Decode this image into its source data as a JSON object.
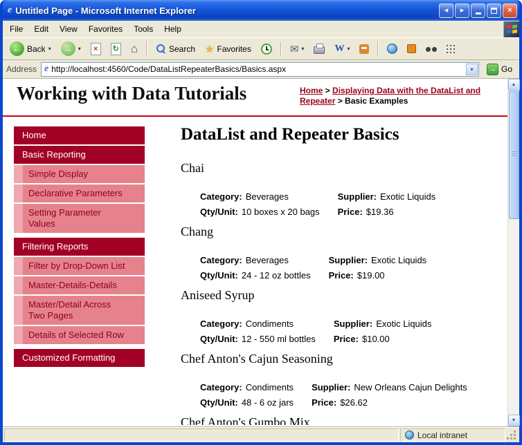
{
  "icons": {
    "ie_logo": "e",
    "window_arrow_left": "◂",
    "window_arrow_right": "▸",
    "close": "×",
    "back_arrow": "←",
    "forward_arrow": "→",
    "stop": "×",
    "refresh": "↻",
    "home": "⌂",
    "favorites_star": "★",
    "mail_envelope": "✉",
    "edit_w": "W",
    "dropdown_caret": "▾",
    "go_arrow": "→",
    "scroll_up": "▲",
    "scroll_down": "▼"
  },
  "window": {
    "title": "Untitled Page - Microsoft Internet Explorer"
  },
  "menu": {
    "items": [
      "File",
      "Edit",
      "View",
      "Favorites",
      "Tools",
      "Help"
    ]
  },
  "toolbar": {
    "back_label": "Back",
    "search_label": "Search",
    "favorites_label": "Favorites"
  },
  "address": {
    "label": "Address",
    "url": "http://localhost:4560/Code/DataListRepeaterBasics/Basics.aspx",
    "go_label": "Go"
  },
  "page": {
    "site_title": "Working with Data Tutorials",
    "breadcrumb": {
      "separator": " > ",
      "items": [
        {
          "label": "Home",
          "link": true
        },
        {
          "label": "Displaying Data with the DataList and Repeater",
          "link": true
        },
        {
          "label": "Basic Examples",
          "link": false
        }
      ]
    },
    "sidebar": [
      {
        "label": "Home",
        "type": "section"
      },
      {
        "label": "Basic Reporting",
        "type": "section"
      },
      {
        "label": "Simple Display",
        "type": "sub"
      },
      {
        "label": "Declarative Parameters",
        "type": "sub"
      },
      {
        "label": "Setting Parameter Values",
        "type": "sub"
      },
      {
        "label": "Filtering Reports",
        "type": "section",
        "gap": true
      },
      {
        "label": "Filter by Drop-Down List",
        "type": "sub"
      },
      {
        "label": "Master-Details-Details",
        "type": "sub"
      },
      {
        "label": "Master/Detail Across Two Pages",
        "type": "sub"
      },
      {
        "label": "Details of Selected Row",
        "type": "sub"
      },
      {
        "label": "Customized Formatting",
        "type": "section",
        "gap": true
      }
    ],
    "main": {
      "title": "DataList and Repeater Basics",
      "labels": {
        "category": "Category:",
        "supplier": "Supplier:",
        "qty": "Qty/Unit:",
        "price": "Price:"
      },
      "products": [
        {
          "name": "Chai",
          "category": "Beverages",
          "supplier": "Exotic Liquids",
          "qty": "10 boxes x 20 bags",
          "price": "$19.36"
        },
        {
          "name": "Chang",
          "category": "Beverages",
          "supplier": "Exotic Liquids",
          "qty": "24 - 12 oz bottles",
          "price": "$19.00"
        },
        {
          "name": "Aniseed Syrup",
          "category": "Condiments",
          "supplier": "Exotic Liquids",
          "qty": "12 - 550 ml bottles",
          "price": "$10.00"
        },
        {
          "name": "Chef Anton's Cajun Seasoning",
          "category": "Condiments",
          "supplier": "New Orleans Cajun Delights",
          "qty": "48 - 6 oz jars",
          "price": "$26.62"
        },
        {
          "name": "Chef Anton's Gumbo Mix"
        }
      ]
    }
  },
  "status": {
    "zone": "Local intranet"
  }
}
